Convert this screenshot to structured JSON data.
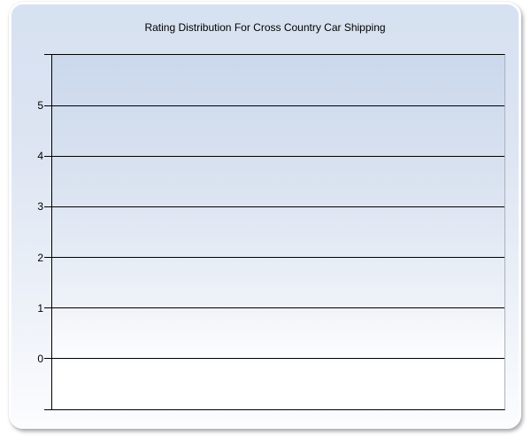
{
  "window": {
    "background_color": "#ffffff"
  },
  "chart_data": {
    "type": "bar",
    "title": "Rating Distribution For Cross Country Car Shipping",
    "categories": [],
    "series": [],
    "values": [],
    "xlabel": "",
    "ylabel": "",
    "ylim": [
      -1,
      6
    ],
    "y_ticks": [
      5,
      4,
      3,
      2,
      1,
      0
    ],
    "x_tick_labels": [],
    "grid": true,
    "legend": false
  },
  "colors": {
    "panel_gradient_top": "#d6e1f1",
    "panel_gradient_bottom": "#fbfcfe",
    "panel_border": "#fdfdfe",
    "panel_shadow": "#7d7d82",
    "plot_gradient_top": "#cbd8ec",
    "plot_gradient_bottom": "#ffffff",
    "gridline": "#000000",
    "axis_line": "#000000",
    "plot_right_border": "#a9b1bf",
    "title_text": "#000000",
    "tick_label_text": "#000000"
  }
}
